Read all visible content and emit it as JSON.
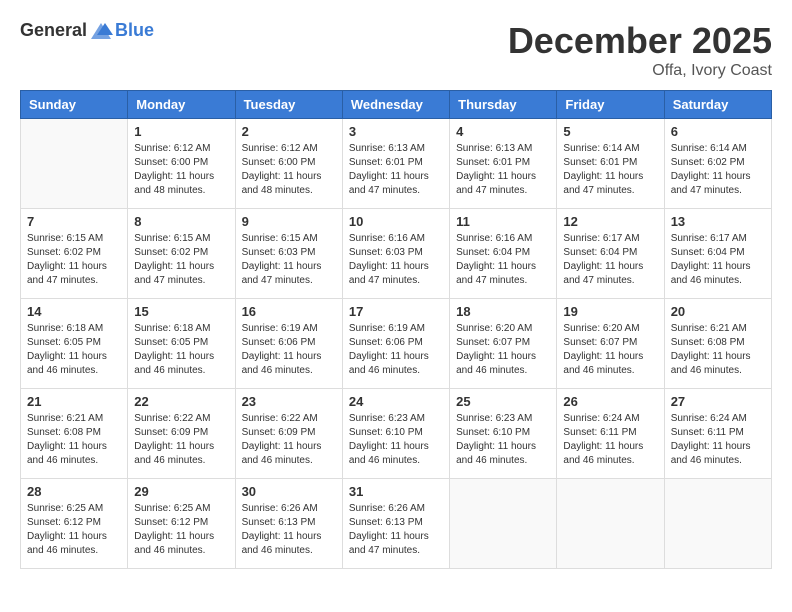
{
  "logo": {
    "general": "General",
    "blue": "Blue"
  },
  "title": {
    "month": "December 2025",
    "location": "Offa, Ivory Coast"
  },
  "headers": [
    "Sunday",
    "Monday",
    "Tuesday",
    "Wednesday",
    "Thursday",
    "Friday",
    "Saturday"
  ],
  "weeks": [
    [
      {
        "day": "",
        "info": ""
      },
      {
        "day": "1",
        "info": "Sunrise: 6:12 AM\nSunset: 6:00 PM\nDaylight: 11 hours\nand 48 minutes."
      },
      {
        "day": "2",
        "info": "Sunrise: 6:12 AM\nSunset: 6:00 PM\nDaylight: 11 hours\nand 48 minutes."
      },
      {
        "day": "3",
        "info": "Sunrise: 6:13 AM\nSunset: 6:01 PM\nDaylight: 11 hours\nand 47 minutes."
      },
      {
        "day": "4",
        "info": "Sunrise: 6:13 AM\nSunset: 6:01 PM\nDaylight: 11 hours\nand 47 minutes."
      },
      {
        "day": "5",
        "info": "Sunrise: 6:14 AM\nSunset: 6:01 PM\nDaylight: 11 hours\nand 47 minutes."
      },
      {
        "day": "6",
        "info": "Sunrise: 6:14 AM\nSunset: 6:02 PM\nDaylight: 11 hours\nand 47 minutes."
      }
    ],
    [
      {
        "day": "7",
        "info": "Sunrise: 6:15 AM\nSunset: 6:02 PM\nDaylight: 11 hours\nand 47 minutes."
      },
      {
        "day": "8",
        "info": "Sunrise: 6:15 AM\nSunset: 6:02 PM\nDaylight: 11 hours\nand 47 minutes."
      },
      {
        "day": "9",
        "info": "Sunrise: 6:15 AM\nSunset: 6:03 PM\nDaylight: 11 hours\nand 47 minutes."
      },
      {
        "day": "10",
        "info": "Sunrise: 6:16 AM\nSunset: 6:03 PM\nDaylight: 11 hours\nand 47 minutes."
      },
      {
        "day": "11",
        "info": "Sunrise: 6:16 AM\nSunset: 6:04 PM\nDaylight: 11 hours\nand 47 minutes."
      },
      {
        "day": "12",
        "info": "Sunrise: 6:17 AM\nSunset: 6:04 PM\nDaylight: 11 hours\nand 47 minutes."
      },
      {
        "day": "13",
        "info": "Sunrise: 6:17 AM\nSunset: 6:04 PM\nDaylight: 11 hours\nand 46 minutes."
      }
    ],
    [
      {
        "day": "14",
        "info": "Sunrise: 6:18 AM\nSunset: 6:05 PM\nDaylight: 11 hours\nand 46 minutes."
      },
      {
        "day": "15",
        "info": "Sunrise: 6:18 AM\nSunset: 6:05 PM\nDaylight: 11 hours\nand 46 minutes."
      },
      {
        "day": "16",
        "info": "Sunrise: 6:19 AM\nSunset: 6:06 PM\nDaylight: 11 hours\nand 46 minutes."
      },
      {
        "day": "17",
        "info": "Sunrise: 6:19 AM\nSunset: 6:06 PM\nDaylight: 11 hours\nand 46 minutes."
      },
      {
        "day": "18",
        "info": "Sunrise: 6:20 AM\nSunset: 6:07 PM\nDaylight: 11 hours\nand 46 minutes."
      },
      {
        "day": "19",
        "info": "Sunrise: 6:20 AM\nSunset: 6:07 PM\nDaylight: 11 hours\nand 46 minutes."
      },
      {
        "day": "20",
        "info": "Sunrise: 6:21 AM\nSunset: 6:08 PM\nDaylight: 11 hours\nand 46 minutes."
      }
    ],
    [
      {
        "day": "21",
        "info": "Sunrise: 6:21 AM\nSunset: 6:08 PM\nDaylight: 11 hours\nand 46 minutes."
      },
      {
        "day": "22",
        "info": "Sunrise: 6:22 AM\nSunset: 6:09 PM\nDaylight: 11 hours\nand 46 minutes."
      },
      {
        "day": "23",
        "info": "Sunrise: 6:22 AM\nSunset: 6:09 PM\nDaylight: 11 hours\nand 46 minutes."
      },
      {
        "day": "24",
        "info": "Sunrise: 6:23 AM\nSunset: 6:10 PM\nDaylight: 11 hours\nand 46 minutes."
      },
      {
        "day": "25",
        "info": "Sunrise: 6:23 AM\nSunset: 6:10 PM\nDaylight: 11 hours\nand 46 minutes."
      },
      {
        "day": "26",
        "info": "Sunrise: 6:24 AM\nSunset: 6:11 PM\nDaylight: 11 hours\nand 46 minutes."
      },
      {
        "day": "27",
        "info": "Sunrise: 6:24 AM\nSunset: 6:11 PM\nDaylight: 11 hours\nand 46 minutes."
      }
    ],
    [
      {
        "day": "28",
        "info": "Sunrise: 6:25 AM\nSunset: 6:12 PM\nDaylight: 11 hours\nand 46 minutes."
      },
      {
        "day": "29",
        "info": "Sunrise: 6:25 AM\nSunset: 6:12 PM\nDaylight: 11 hours\nand 46 minutes."
      },
      {
        "day": "30",
        "info": "Sunrise: 6:26 AM\nSunset: 6:13 PM\nDaylight: 11 hours\nand 46 minutes."
      },
      {
        "day": "31",
        "info": "Sunrise: 6:26 AM\nSunset: 6:13 PM\nDaylight: 11 hours\nand 47 minutes."
      },
      {
        "day": "",
        "info": ""
      },
      {
        "day": "",
        "info": ""
      },
      {
        "day": "",
        "info": ""
      }
    ]
  ]
}
